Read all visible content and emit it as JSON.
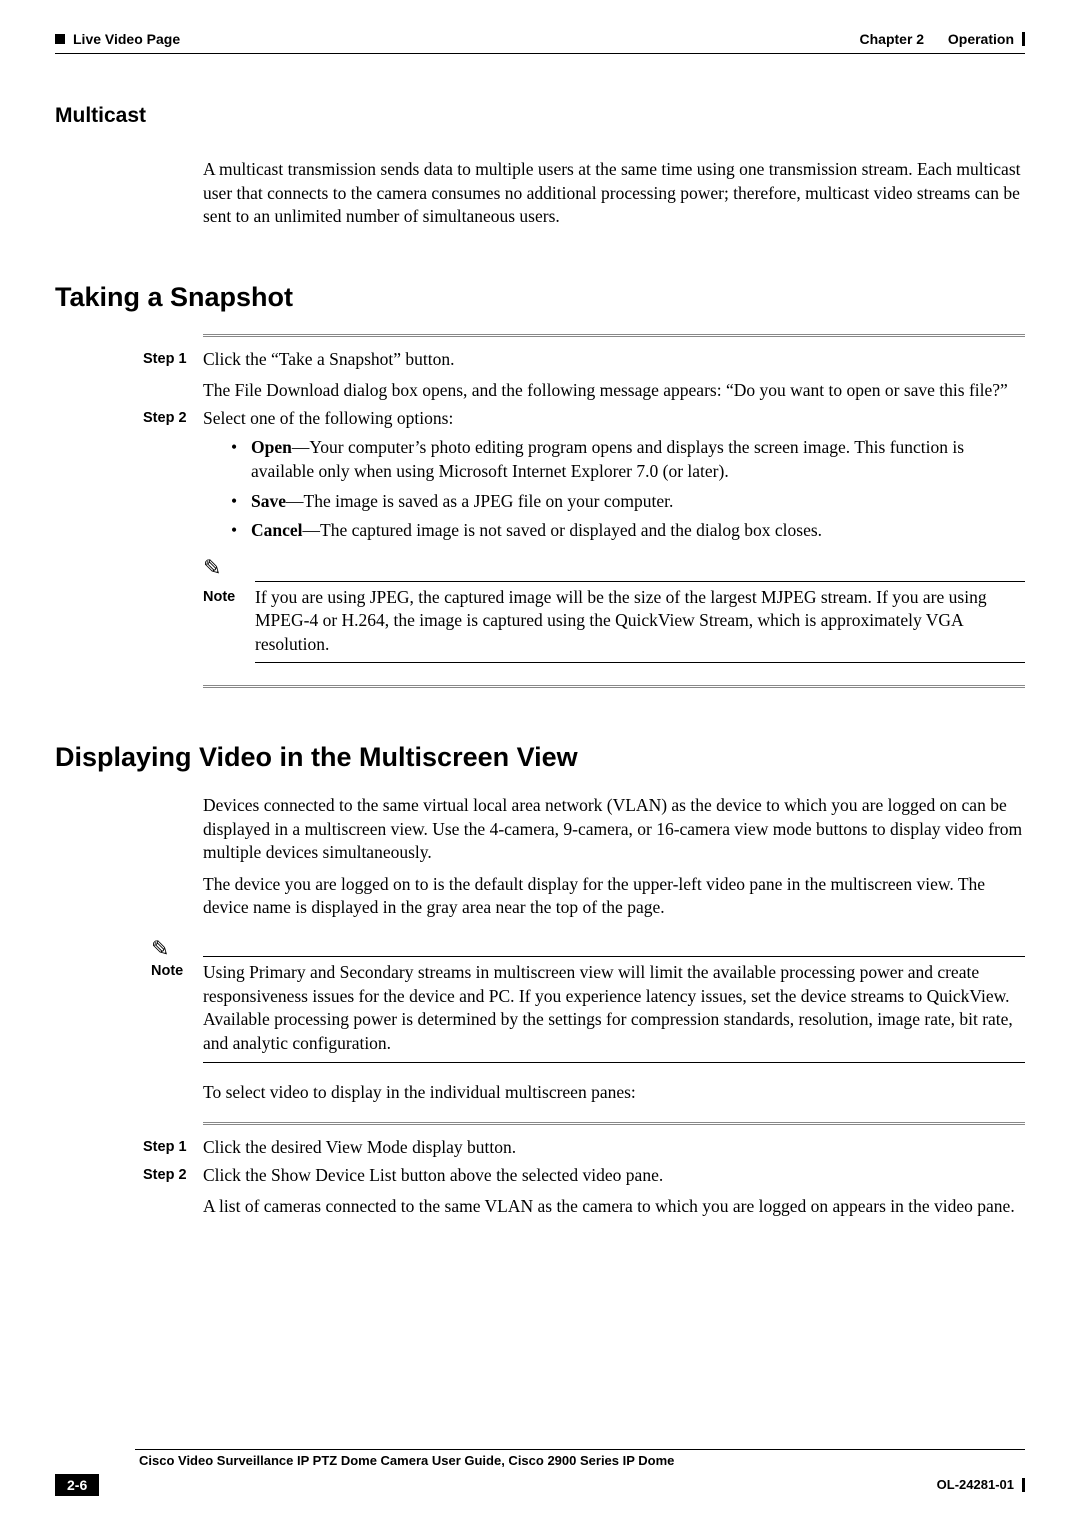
{
  "header": {
    "chapter_label": "Chapter 2",
    "chapter_title": "Operation",
    "section_title": "Live Video Page"
  },
  "multicast": {
    "heading": "Multicast",
    "body": "A multicast transmission sends data to multiple users at the same time using one transmission stream. Each multicast user that connects to the camera consumes no additional processing power; therefore, multicast video streams can be sent to an unlimited number of simultaneous users."
  },
  "snapshot": {
    "heading": "Taking a Snapshot",
    "step1_label": "Step 1",
    "step1_line1": "Click the “Take a Snapshot” button.",
    "step1_line2": "The File Download dialog box opens, and the following message appears: “Do you want to open or save this file?”",
    "step2_label": "Step 2",
    "step2_intro": "Select one of the following options:",
    "bullet_open_bold": "Open",
    "bullet_open_text": "—Your computer’s photo editing program opens and displays the screen image. This function is available only when using Microsoft Internet Explorer 7.0 (or later).",
    "bullet_save_bold": "Save",
    "bullet_save_text": "—The image is saved as a JPEG file on your computer.",
    "bullet_cancel_bold": "Cancel",
    "bullet_cancel_text": "—The captured image is not saved or displayed and the dialog box closes.",
    "note_label": "Note",
    "note_text": "If you are using JPEG, the captured image will be the size of the largest MJPEG stream. If you are using MPEG-4 or H.264, the image is captured using the QuickView Stream, which is approximately VGA resolution."
  },
  "multiscreen": {
    "heading": "Displaying Video in the Multiscreen View",
    "p1": "Devices connected to the same virtual local area network (VLAN) as the device to which you are logged on can be displayed in a multiscreen view. Use the 4-camera, 9-camera, or 16-camera view mode buttons to display video from multiple devices simultaneously.",
    "p2": "The device you are logged on to is the default display for the upper-left video pane in the multiscreen view. The device name is displayed in the gray area near the top of the page.",
    "note_label": "Note",
    "note_text": "Using Primary and Secondary streams in multiscreen view will limit the available processing power and create responsiveness issues for the device and PC. If you experience latency issues, set the device streams to QuickView. Available processing power is determined by the settings for compression standards, resolution, image rate, bit rate, and analytic configuration.",
    "p3": "To select video to display in the individual multiscreen panes:",
    "step1_label": "Step 1",
    "step1_text": "Click the desired View Mode display button.",
    "step2_label": "Step 2",
    "step2_line1": "Click the Show Device List button above the selected video pane.",
    "step2_line2": "A list of cameras connected to the same VLAN as the camera to which you are logged on appears in the video pane."
  },
  "footer": {
    "guide_title": "Cisco Video Surveillance IP PTZ Dome Camera User Guide, Cisco 2900 Series IP Dome",
    "page_number": "2-6",
    "doc_id": "OL-24281-01"
  }
}
